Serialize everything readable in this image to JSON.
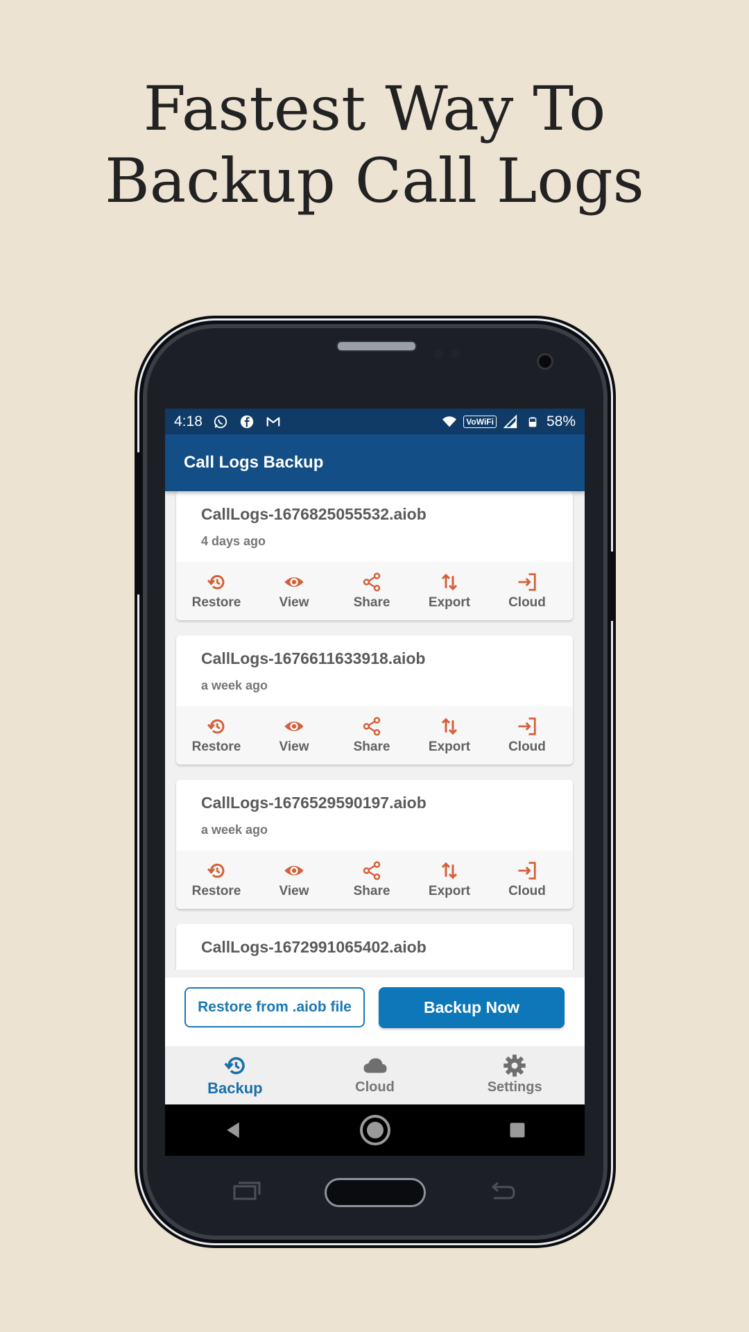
{
  "headline": {
    "line1": "Fastest Way To",
    "line2": "Backup Call Logs"
  },
  "status_bar": {
    "time": "4:18",
    "vowifi": "VoWiFi",
    "battery": "58%"
  },
  "app_bar": {
    "title": "Call Logs Backup"
  },
  "backups": [
    {
      "name": "CallLogs-1676825055532.aiob",
      "time": "4 days ago"
    },
    {
      "name": "CallLogs-1676611633918.aiob",
      "time": "a week ago"
    },
    {
      "name": "CallLogs-1676529590197.aiob",
      "time": "a week ago"
    },
    {
      "name": "CallLogs-1672991065402.aiob",
      "time": ""
    }
  ],
  "actions": {
    "restore": "Restore",
    "view": "View",
    "share": "Share",
    "export": "Export",
    "cloud": "Cloud"
  },
  "buttons": {
    "restore_file": "Restore from .aiob file",
    "backup_now": "Backup Now"
  },
  "bottom_nav": {
    "backup": "Backup",
    "cloud": "Cloud",
    "settings": "Settings",
    "active": "Backup"
  },
  "colors": {
    "accent_orange": "#d4603a",
    "primary_dark": "#134f86",
    "status_bar": "#0f3b66",
    "button_blue": "#0d77b9",
    "background": "#ece3d2"
  }
}
